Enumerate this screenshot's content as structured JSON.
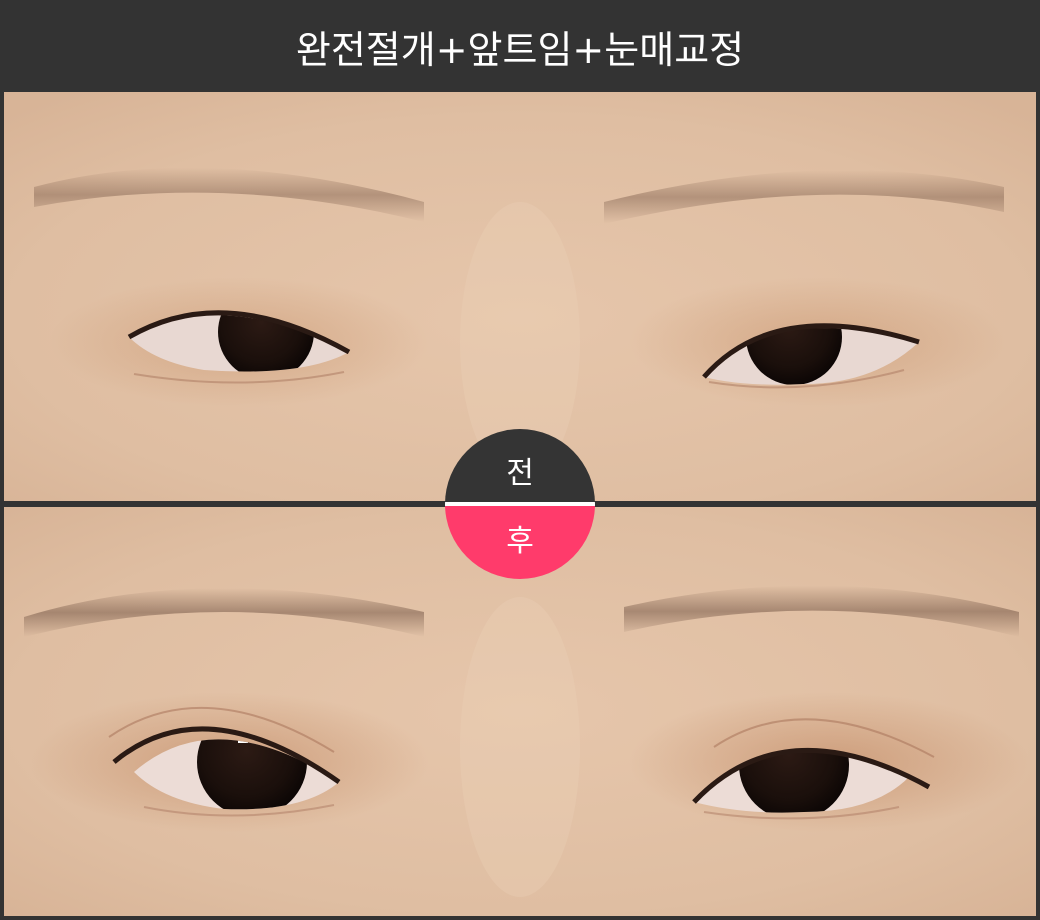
{
  "header": {
    "title": "완전절개+앞트임+눈매교정"
  },
  "badge": {
    "before_label": "전",
    "after_label": "후",
    "before_color": "#343434",
    "after_color": "#ff3b6b"
  },
  "photos": {
    "before": "before-eyes-photo",
    "after": "after-eyes-photo"
  },
  "colors": {
    "background": "#333333",
    "skin": "#e3c3a9"
  }
}
